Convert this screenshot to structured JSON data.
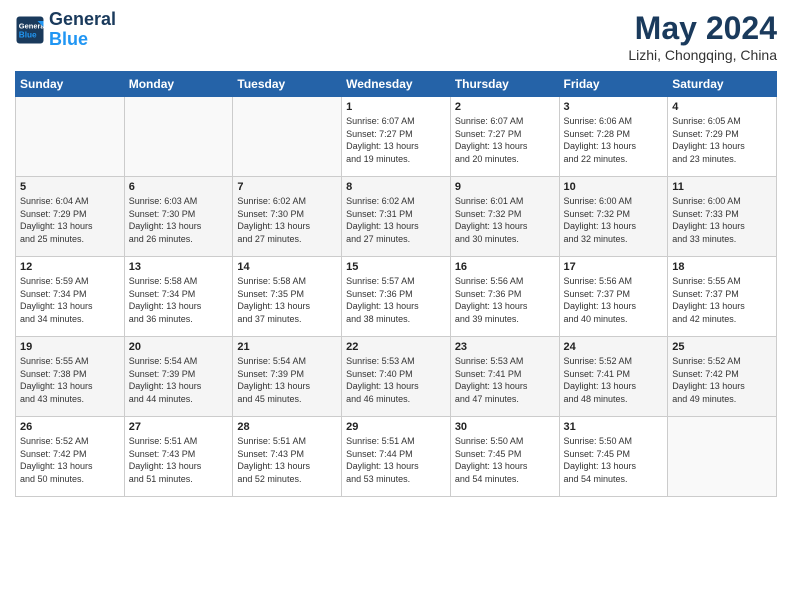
{
  "header": {
    "logo_general": "General",
    "logo_blue": "Blue",
    "month_year": "May 2024",
    "location": "Lizhi, Chongqing, China"
  },
  "days_of_week": [
    "Sunday",
    "Monday",
    "Tuesday",
    "Wednesday",
    "Thursday",
    "Friday",
    "Saturday"
  ],
  "weeks": [
    [
      {
        "day": "",
        "info": ""
      },
      {
        "day": "",
        "info": ""
      },
      {
        "day": "",
        "info": ""
      },
      {
        "day": "1",
        "info": "Sunrise: 6:07 AM\nSunset: 7:27 PM\nDaylight: 13 hours\nand 19 minutes."
      },
      {
        "day": "2",
        "info": "Sunrise: 6:07 AM\nSunset: 7:27 PM\nDaylight: 13 hours\nand 20 minutes."
      },
      {
        "day": "3",
        "info": "Sunrise: 6:06 AM\nSunset: 7:28 PM\nDaylight: 13 hours\nand 22 minutes."
      },
      {
        "day": "4",
        "info": "Sunrise: 6:05 AM\nSunset: 7:29 PM\nDaylight: 13 hours\nand 23 minutes."
      }
    ],
    [
      {
        "day": "5",
        "info": "Sunrise: 6:04 AM\nSunset: 7:29 PM\nDaylight: 13 hours\nand 25 minutes."
      },
      {
        "day": "6",
        "info": "Sunrise: 6:03 AM\nSunset: 7:30 PM\nDaylight: 13 hours\nand 26 minutes."
      },
      {
        "day": "7",
        "info": "Sunrise: 6:02 AM\nSunset: 7:30 PM\nDaylight: 13 hours\nand 27 minutes."
      },
      {
        "day": "8",
        "info": "Sunrise: 6:02 AM\nSunset: 7:31 PM\nDaylight: 13 hours\nand 27 minutes."
      },
      {
        "day": "9",
        "info": "Sunrise: 6:01 AM\nSunset: 7:32 PM\nDaylight: 13 hours\nand 30 minutes."
      },
      {
        "day": "10",
        "info": "Sunrise: 6:00 AM\nSunset: 7:32 PM\nDaylight: 13 hours\nand 32 minutes."
      },
      {
        "day": "11",
        "info": "Sunrise: 6:00 AM\nSunset: 7:33 PM\nDaylight: 13 hours\nand 33 minutes."
      }
    ],
    [
      {
        "day": "12",
        "info": "Sunrise: 5:59 AM\nSunset: 7:34 PM\nDaylight: 13 hours\nand 34 minutes."
      },
      {
        "day": "13",
        "info": "Sunrise: 5:58 AM\nSunset: 7:34 PM\nDaylight: 13 hours\nand 36 minutes."
      },
      {
        "day": "14",
        "info": "Sunrise: 5:58 AM\nSunset: 7:35 PM\nDaylight: 13 hours\nand 37 minutes."
      },
      {
        "day": "15",
        "info": "Sunrise: 5:57 AM\nSunset: 7:36 PM\nDaylight: 13 hours\nand 38 minutes."
      },
      {
        "day": "16",
        "info": "Sunrise: 5:56 AM\nSunset: 7:36 PM\nDaylight: 13 hours\nand 39 minutes."
      },
      {
        "day": "17",
        "info": "Sunrise: 5:56 AM\nSunset: 7:37 PM\nDaylight: 13 hours\nand 40 minutes."
      },
      {
        "day": "18",
        "info": "Sunrise: 5:55 AM\nSunset: 7:37 PM\nDaylight: 13 hours\nand 42 minutes."
      }
    ],
    [
      {
        "day": "19",
        "info": "Sunrise: 5:55 AM\nSunset: 7:38 PM\nDaylight: 13 hours\nand 43 minutes."
      },
      {
        "day": "20",
        "info": "Sunrise: 5:54 AM\nSunset: 7:39 PM\nDaylight: 13 hours\nand 44 minutes."
      },
      {
        "day": "21",
        "info": "Sunrise: 5:54 AM\nSunset: 7:39 PM\nDaylight: 13 hours\nand 45 minutes."
      },
      {
        "day": "22",
        "info": "Sunrise: 5:53 AM\nSunset: 7:40 PM\nDaylight: 13 hours\nand 46 minutes."
      },
      {
        "day": "23",
        "info": "Sunrise: 5:53 AM\nSunset: 7:41 PM\nDaylight: 13 hours\nand 47 minutes."
      },
      {
        "day": "24",
        "info": "Sunrise: 5:52 AM\nSunset: 7:41 PM\nDaylight: 13 hours\nand 48 minutes."
      },
      {
        "day": "25",
        "info": "Sunrise: 5:52 AM\nSunset: 7:42 PM\nDaylight: 13 hours\nand 49 minutes."
      }
    ],
    [
      {
        "day": "26",
        "info": "Sunrise: 5:52 AM\nSunset: 7:42 PM\nDaylight: 13 hours\nand 50 minutes."
      },
      {
        "day": "27",
        "info": "Sunrise: 5:51 AM\nSunset: 7:43 PM\nDaylight: 13 hours\nand 51 minutes."
      },
      {
        "day": "28",
        "info": "Sunrise: 5:51 AM\nSunset: 7:43 PM\nDaylight: 13 hours\nand 52 minutes."
      },
      {
        "day": "29",
        "info": "Sunrise: 5:51 AM\nSunset: 7:44 PM\nDaylight: 13 hours\nand 53 minutes."
      },
      {
        "day": "30",
        "info": "Sunrise: 5:50 AM\nSunset: 7:45 PM\nDaylight: 13 hours\nand 54 minutes."
      },
      {
        "day": "31",
        "info": "Sunrise: 5:50 AM\nSunset: 7:45 PM\nDaylight: 13 hours\nand 54 minutes."
      },
      {
        "day": "",
        "info": ""
      }
    ]
  ]
}
